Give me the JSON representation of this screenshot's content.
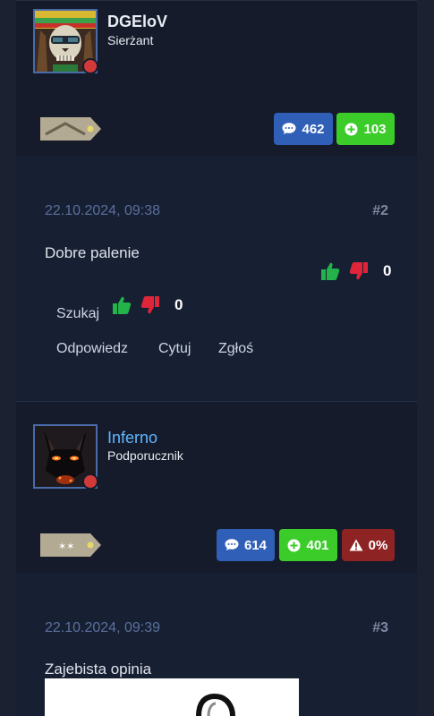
{
  "colors": {
    "background": "#1b2130",
    "panel": "#151b2a",
    "posts_badge": "#2f5fb7",
    "points_badge": "#3bcc2a",
    "warn_badge": "#8e2323",
    "thumb_up": "#23b34a",
    "thumb_down": "#e0243a",
    "offline": "#d23a3a"
  },
  "user1": {
    "name": "DGEloV",
    "rank": "Sierżant",
    "posts": "462",
    "points": "103",
    "avatar_icon": "skull-rasta-avatar",
    "rank_icon": "sergeant-epaulette-icon"
  },
  "post2": {
    "date": "22.10.2024, 09:38",
    "number": "#2",
    "text": "Dobre palenie",
    "score": "0",
    "search_label": "Szukaj",
    "search_score": "0",
    "actions": {
      "reply": "Odpowiedz",
      "quote": "Cytuj",
      "report": "Zgłoś"
    }
  },
  "user2": {
    "name": "Inferno",
    "rank": "Podporucznik",
    "posts": "614",
    "points": "401",
    "warnings": "0%",
    "avatar_icon": "demon-cat-avatar",
    "rank_icon": "second-lieutenant-epaulette-icon"
  },
  "post3": {
    "date": "22.10.2024, 09:39",
    "number": "#3",
    "text": "Zajebista opinia"
  }
}
